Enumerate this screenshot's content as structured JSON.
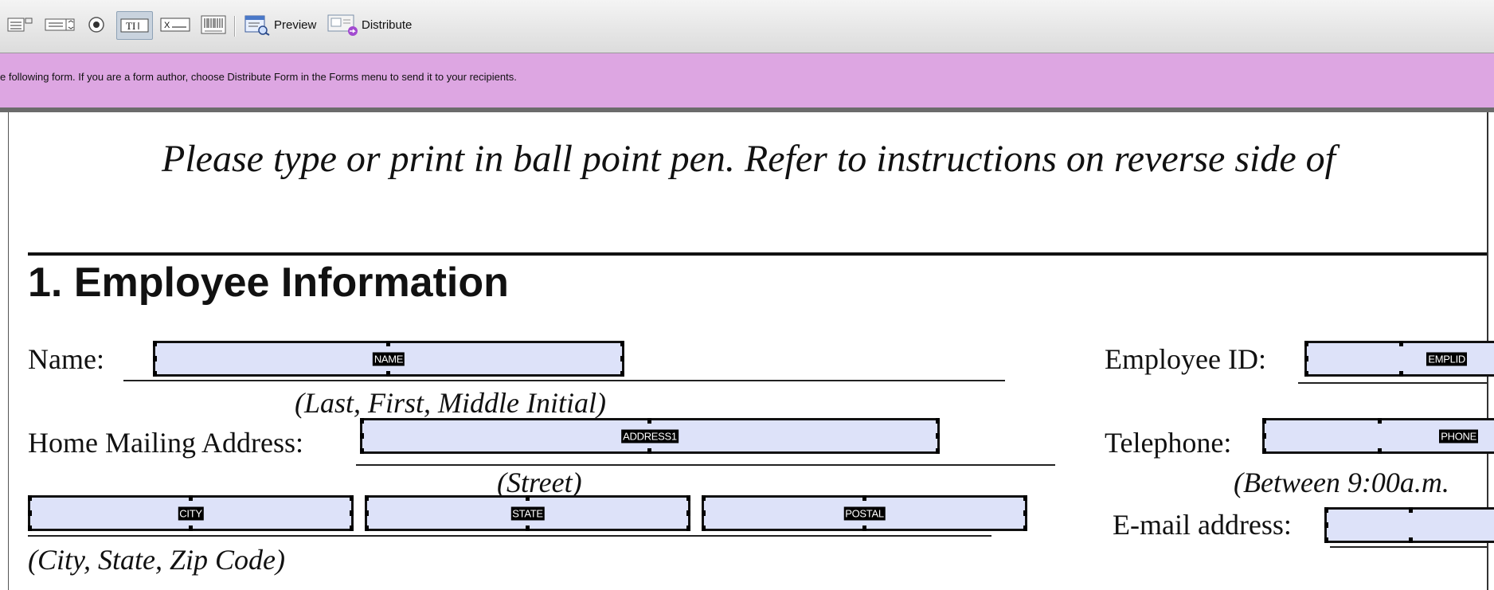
{
  "toolbar": {
    "preview_label": "Preview",
    "distribute_label": "Distribute"
  },
  "banner": {
    "message": "e following form. If you are a form author, choose Distribute Form in the Forms menu to send it to your recipients."
  },
  "form": {
    "instruction": "Please type or print in ball point pen. Refer to instructions on reverse side of",
    "section_title": "1. Employee Information",
    "labels": {
      "name": "Name:",
      "name_hint": "(Last, First, Middle Initial)",
      "address": "Home Mailing Address:",
      "street_hint": "(Street)",
      "city_hint": "(City, State, Zip Code)",
      "employee_id": "Employee ID:",
      "telephone": "Telephone:",
      "phone_hint": "(Between 9:00a.m.",
      "email": "E-mail address:"
    },
    "fields": {
      "name": "NAME",
      "address1": "ADDRESS1",
      "city": "CITY",
      "state": "STATE",
      "postal": "POSTAL",
      "emplid": "EMPLID",
      "phone": "PHONE"
    }
  },
  "colors": {
    "banner": "#dda6e2",
    "field_fill": "#dde2f9"
  }
}
